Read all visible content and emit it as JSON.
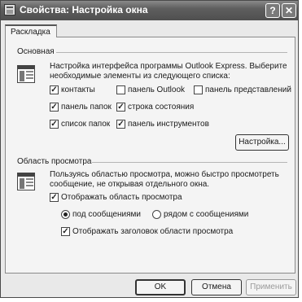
{
  "window": {
    "title": "Свойства: Настройка окна"
  },
  "titlebar_buttons": {
    "help": "?",
    "close": "✕"
  },
  "tab": {
    "label": "Раскладка"
  },
  "basic": {
    "title": "Основная",
    "description": "Настройка интерфейса программы Outlook Express. Выберите необходимые элементы из следующего списка:",
    "options": [
      {
        "label": "контакты",
        "checked": true
      },
      {
        "label": "панель Outlook",
        "checked": false
      },
      {
        "label": "панель представлений",
        "checked": false
      },
      {
        "label": "панель папок",
        "checked": true
      },
      {
        "label": "строка состояния",
        "checked": true
      },
      {
        "label": "список папок",
        "checked": true
      },
      {
        "label": "панель инструментов",
        "checked": true
      }
    ],
    "customize_button": "Настройка..."
  },
  "preview": {
    "title": "Область просмотра",
    "description": "Пользуясь областью просмотра, можно быстро просмотреть сообщение, не открывая отдельного окна.",
    "show_preview": {
      "label": "Отображать область просмотра",
      "checked": true
    },
    "radio_below": {
      "label": "под сообщениями",
      "selected": true
    },
    "radio_beside": {
      "label": "рядом с сообщениями",
      "selected": false
    },
    "show_header": {
      "label": "Отображать заголовок области просмотра",
      "checked": true
    }
  },
  "buttons": {
    "ok": "OK",
    "cancel": "Отмена",
    "apply": "Применить"
  }
}
